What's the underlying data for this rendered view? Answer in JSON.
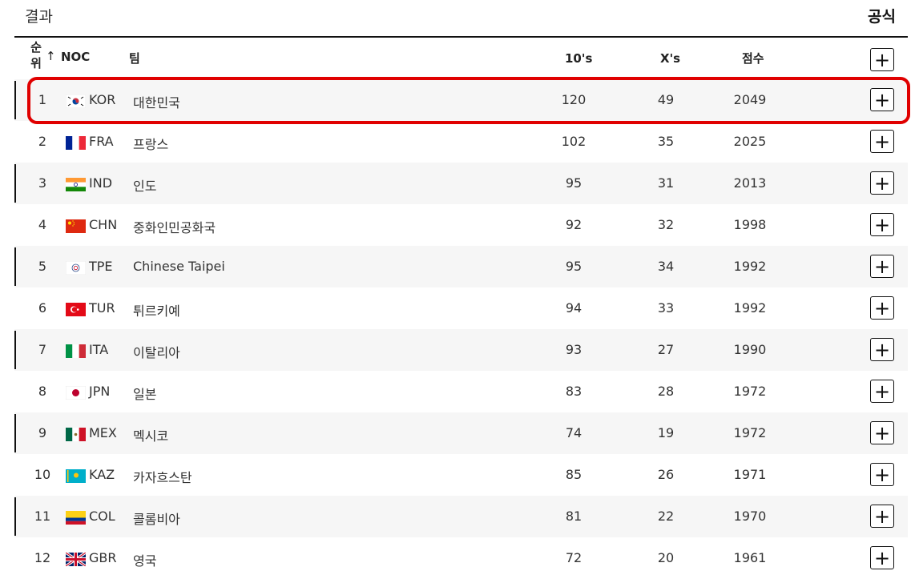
{
  "header": {
    "title": "결과",
    "official": "공식"
  },
  "columns": {
    "rank": "순위",
    "sort_arrow": "↑",
    "noc": "NOC",
    "team": "팀",
    "tens": "10's",
    "xs": "X's",
    "score": "점수",
    "expand": "+"
  },
  "rows": [
    {
      "rank": "1",
      "flag": "kor-flag-icon",
      "noc": "KOR",
      "team": "대한민국",
      "tens": "120",
      "xs": "49",
      "score": "2049",
      "expand": "+"
    },
    {
      "rank": "2",
      "flag": "fra-flag-icon",
      "noc": "FRA",
      "team": "프랑스",
      "tens": "102",
      "xs": "35",
      "score": "2025",
      "expand": "+"
    },
    {
      "rank": "3",
      "flag": "ind-flag-icon",
      "noc": "IND",
      "team": "인도",
      "tens": "95",
      "xs": "31",
      "score": "2013",
      "expand": "+"
    },
    {
      "rank": "4",
      "flag": "chn-flag-icon",
      "noc": "CHN",
      "team": "중화인민공화국",
      "tens": "92",
      "xs": "32",
      "score": "1998",
      "expand": "+"
    },
    {
      "rank": "5",
      "flag": "tpe-flag-icon",
      "noc": "TPE",
      "team": "Chinese Taipei",
      "tens": "95",
      "xs": "34",
      "score": "1992",
      "expand": "+"
    },
    {
      "rank": "6",
      "flag": "tur-flag-icon",
      "noc": "TUR",
      "team": "튀르키예",
      "tens": "94",
      "xs": "33",
      "score": "1992",
      "expand": "+"
    },
    {
      "rank": "7",
      "flag": "ita-flag-icon",
      "noc": "ITA",
      "team": "이탈리아",
      "tens": "93",
      "xs": "27",
      "score": "1990",
      "expand": "+"
    },
    {
      "rank": "8",
      "flag": "jpn-flag-icon",
      "noc": "JPN",
      "team": "일본",
      "tens": "83",
      "xs": "28",
      "score": "1972",
      "expand": "+"
    },
    {
      "rank": "9",
      "flag": "mex-flag-icon",
      "noc": "MEX",
      "team": "멕시코",
      "tens": "74",
      "xs": "19",
      "score": "1972",
      "expand": "+"
    },
    {
      "rank": "10",
      "flag": "kaz-flag-icon",
      "noc": "KAZ",
      "team": "카자흐스탄",
      "tens": "85",
      "xs": "26",
      "score": "1971",
      "expand": "+"
    },
    {
      "rank": "11",
      "flag": "col-flag-icon",
      "noc": "COL",
      "team": "콜롬비아",
      "tens": "81",
      "xs": "22",
      "score": "1970",
      "expand": "+"
    },
    {
      "rank": "12",
      "flag": "gbr-flag-icon",
      "noc": "GBR",
      "team": "영국",
      "tens": "72",
      "xs": "20",
      "score": "1961",
      "expand": "+"
    }
  ],
  "highlight_color": "#e00000"
}
